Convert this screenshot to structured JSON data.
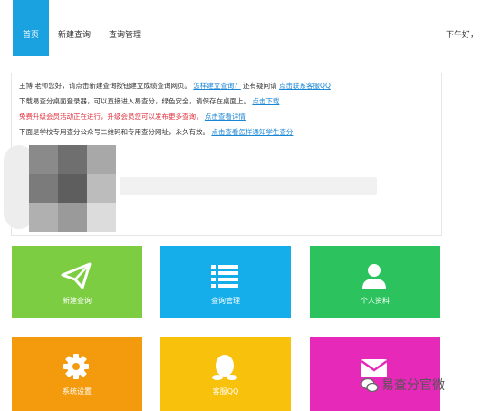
{
  "nav": {
    "items": [
      {
        "label": "首页",
        "active": true
      },
      {
        "label": "新建查询",
        "active": false
      },
      {
        "label": "查询管理",
        "active": false
      }
    ],
    "greeting": "下午好，"
  },
  "notice": {
    "line1": {
      "text": "王博 老师您好，请点击新建查询按钮建立成绩查询网页。",
      "link1": "怎样建立查询？",
      "mid": "还有疑问请",
      "link2": "点击联系客服QQ"
    },
    "line2": {
      "text": "下载易查分桌面登录器，可以直接进入易查分，绿色安全，请保存在桌面上。",
      "link": "点击下载"
    },
    "line3": {
      "text": "免费升级会员活动正在进行，升级会员您可以发布更多查询，",
      "link": "点击查看详情"
    },
    "line4": {
      "text": "下面是学校专用查分公众号二维码和专用查分网址，永久有效。",
      "link": "点击查看怎样通知学生查分"
    }
  },
  "tiles": [
    {
      "label": "新建查询",
      "icon": "paper-plane-icon",
      "color": "#7dcd43"
    },
    {
      "label": "查询管理",
      "icon": "list-icon",
      "color": "#16aeea"
    },
    {
      "label": "个人资料",
      "icon": "user-icon",
      "color": "#2cc35e"
    },
    {
      "label": "系统设置",
      "icon": "gear-icon",
      "color": "#f39a0d"
    },
    {
      "label": "客服QQ",
      "icon": "qq-penguin-icon",
      "color": "#f8c10c"
    },
    {
      "label": "",
      "icon": "mail-icon",
      "color": "#e629b8"
    }
  ],
  "watermark": {
    "text": "易查分官微",
    "icon": "wechat-icon"
  },
  "colors": {
    "accent": "#1aa1e0",
    "link": "#1a86d6",
    "alert": "#e0313d"
  }
}
